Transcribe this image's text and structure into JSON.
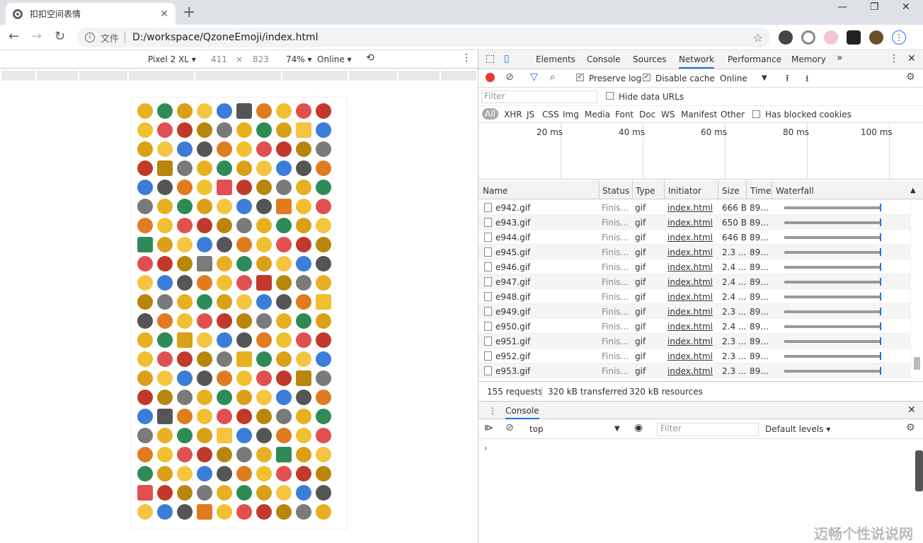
{
  "browser": {
    "tab_title": "扣扣空间表情",
    "tab_close": "✕",
    "new_tab": "+",
    "win_min": "—",
    "win_max": "❐",
    "win_close": "✕",
    "back": "←",
    "forward": "→",
    "reload": "↻",
    "address_label": "文件",
    "url": "D:/workspace/QzoneEmoji/index.html",
    "star": "☆"
  },
  "device_toolbar": {
    "device": "Pixel 2 XL ▾",
    "width": "411",
    "times": "×",
    "height": "823",
    "zoom": "74% ▾",
    "network": "Online ▾",
    "rotate": "⟲",
    "more": "⋮"
  },
  "devtools": {
    "tabs": [
      "Elements",
      "Console",
      "Sources",
      "Network",
      "Performance",
      "Memory"
    ],
    "more_tabs": "»",
    "menu": "⋮",
    "close": "✕",
    "network_toolbar": {
      "preserve_log": "Preserve log",
      "disable_cache": "Disable cache",
      "throttle": "Online",
      "throttle_arrow": "▼"
    },
    "filter_placeholder": "Filter",
    "hide_data_urls": "Hide data URLs",
    "types": [
      "All",
      "XHR",
      "JS",
      "CSS",
      "Img",
      "Media",
      "Font",
      "Doc",
      "WS",
      "Manifest",
      "Other"
    ],
    "has_blocked_cookies": "Has blocked cookies",
    "timeline_ticks": [
      "20 ms",
      "40 ms",
      "60 ms",
      "80 ms",
      "100 ms"
    ],
    "columns": [
      "Name",
      "Status",
      "Type",
      "Initiator",
      "Size",
      "Time",
      "Waterfall"
    ],
    "sort_arrow": "▲",
    "requests": [
      {
        "name": "e942.gif",
        "status": "Finis...",
        "type": "gif",
        "initiator": "index.html",
        "size": "666 B",
        "time": "89..."
      },
      {
        "name": "e943.gif",
        "status": "Finis...",
        "type": "gif",
        "initiator": "index.html",
        "size": "650 B",
        "time": "89..."
      },
      {
        "name": "e944.gif",
        "status": "Finis...",
        "type": "gif",
        "initiator": "index.html",
        "size": "646 B",
        "time": "89..."
      },
      {
        "name": "e945.gif",
        "status": "Finis...",
        "type": "gif",
        "initiator": "index.html",
        "size": "2.3 ...",
        "time": "89..."
      },
      {
        "name": "e946.gif",
        "status": "Finis...",
        "type": "gif",
        "initiator": "index.html",
        "size": "2.4 ...",
        "time": "89..."
      },
      {
        "name": "e947.gif",
        "status": "Finis...",
        "type": "gif",
        "initiator": "index.html",
        "size": "2.4 ...",
        "time": "89..."
      },
      {
        "name": "e948.gif",
        "status": "Finis...",
        "type": "gif",
        "initiator": "index.html",
        "size": "2.4 ...",
        "time": "89..."
      },
      {
        "name": "e949.gif",
        "status": "Finis...",
        "type": "gif",
        "initiator": "index.html",
        "size": "2.3 ...",
        "time": "89..."
      },
      {
        "name": "e950.gif",
        "status": "Finis...",
        "type": "gif",
        "initiator": "index.html",
        "size": "2.4 ...",
        "time": "89..."
      },
      {
        "name": "e951.gif",
        "status": "Finis...",
        "type": "gif",
        "initiator": "index.html",
        "size": "2.3 ...",
        "time": "89..."
      },
      {
        "name": "e952.gif",
        "status": "Finis...",
        "type": "gif",
        "initiator": "index.html",
        "size": "2.3 ...",
        "time": "89..."
      },
      {
        "name": "e953.gif",
        "status": "Finis...",
        "type": "gif",
        "initiator": "index.html",
        "size": "2.3 ...",
        "time": "89..."
      }
    ],
    "summary": {
      "requests": "155 requests",
      "transferred": "320 kB transferred",
      "resources": "320 kB resources"
    },
    "drawer": {
      "menu": "⋮",
      "tab": "Console",
      "close": "✕"
    },
    "console_toolbar": {
      "context": "top",
      "context_arrow": "▼",
      "filter_placeholder": "Filter",
      "levels": "Default levels ▾"
    },
    "prompt": "›"
  },
  "watermark": "迈畅个性说说网",
  "emoji_palette": [
    "#e8b020",
    "#f0c030",
    "#d9a018",
    "#c0392b",
    "#3b7dd8",
    "#7a7a7a",
    "#e07b20",
    "#2e8b57",
    "#e05050",
    "#f5c542",
    "#b8860b",
    "#555555"
  ]
}
